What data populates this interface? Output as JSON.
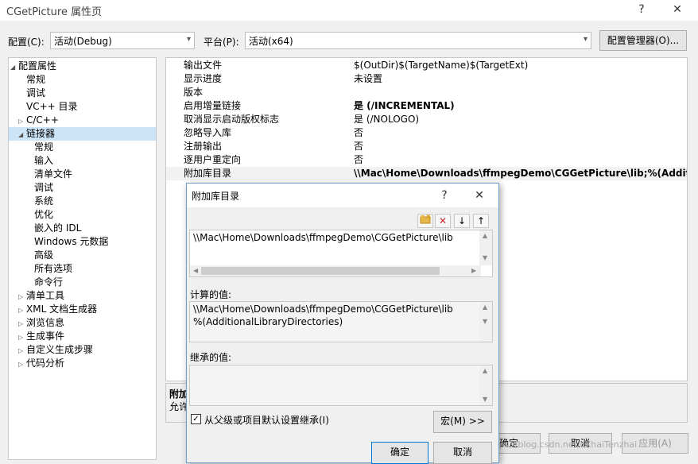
{
  "window": {
    "title": "CGetPicture 属性页",
    "help": "?",
    "close": "✕"
  },
  "config": {
    "config_label": "配置(C):",
    "config_value": "活动(Debug)",
    "platform_label": "平台(P):",
    "platform_value": "活动(x64)",
    "manager_button": "配置管理器(O)..."
  },
  "tree": [
    {
      "label": "配置属性",
      "level": 0,
      "expander": "open"
    },
    {
      "label": "常规",
      "level": 1
    },
    {
      "label": "调试",
      "level": 1
    },
    {
      "label": "VC++ 目录",
      "level": 1
    },
    {
      "label": "C/C++",
      "level": 1,
      "expander": "closed"
    },
    {
      "label": "链接器",
      "level": 1,
      "expander": "open",
      "selected": true
    },
    {
      "label": "常规",
      "level": 2
    },
    {
      "label": "输入",
      "level": 2
    },
    {
      "label": "清单文件",
      "level": 2
    },
    {
      "label": "调试",
      "level": 2
    },
    {
      "label": "系统",
      "level": 2
    },
    {
      "label": "优化",
      "level": 2
    },
    {
      "label": "嵌入的 IDL",
      "level": 2
    },
    {
      "label": "Windows 元数据",
      "level": 2
    },
    {
      "label": "高级",
      "level": 2
    },
    {
      "label": "所有选项",
      "level": 2
    },
    {
      "label": "命令行",
      "level": 2
    },
    {
      "label": "清单工具",
      "level": 1,
      "expander": "closed"
    },
    {
      "label": "XML 文档生成器",
      "level": 1,
      "expander": "closed"
    },
    {
      "label": "浏览信息",
      "level": 1,
      "expander": "closed"
    },
    {
      "label": "生成事件",
      "level": 1,
      "expander": "closed"
    },
    {
      "label": "自定义生成步骤",
      "level": 1,
      "expander": "closed"
    },
    {
      "label": "代码分析",
      "level": 1,
      "expander": "closed"
    }
  ],
  "properties": [
    {
      "name": "输出文件",
      "value": "$(OutDir)$(TargetName)$(TargetExt)"
    },
    {
      "name": "显示进度",
      "value": "未设置"
    },
    {
      "name": "版本",
      "value": ""
    },
    {
      "name": "启用增量链接",
      "value": "是 (/INCREMENTAL)",
      "bold": true
    },
    {
      "name": "取消显示启动版权标志",
      "value": "是 (/NOLOGO)"
    },
    {
      "name": "忽略导入库",
      "value": "否"
    },
    {
      "name": "注册输出",
      "value": "否"
    },
    {
      "name": "逐用户重定向",
      "value": "否"
    },
    {
      "name": "附加库目录",
      "value": "\\\\Mac\\Home\\Downloads\\ffmpegDemo\\CGGetPicture\\lib;%(Additiona",
      "bold": true,
      "highlight": true
    }
  ],
  "description": {
    "title": "附加",
    "text": "允许"
  },
  "main_buttons": {
    "ok": "确定",
    "cancel": "取消",
    "apply": "应用(A)"
  },
  "dialog": {
    "title": "附加库目录",
    "help": "?",
    "close": "✕",
    "list_items": [
      "\\\\Mac\\Home\\Downloads\\ffmpegDemo\\CGGetPicture\\lib"
    ],
    "computed_label": "计算的值:",
    "computed_lines": [
      "\\\\Mac\\Home\\Downloads\\ffmpegDemo\\CGGetPicture\\lib",
      "%(AdditionalLibraryDirectories)"
    ],
    "inherited_label": "继承的值:",
    "inherit_checkbox": "从父级或项目默认设置继承(I)",
    "macro_button": "宏(M) >>",
    "ok_button": "确定",
    "cancel_button": "取消"
  },
  "watermark": "https://blog.csdn.net/cXhaiTenzhai",
  "colors": {
    "selection": "#cce4f7",
    "dialog_border": "#6ca0d0",
    "delete_icon": "#c8262d",
    "folder_icon": "#e8b84a"
  }
}
